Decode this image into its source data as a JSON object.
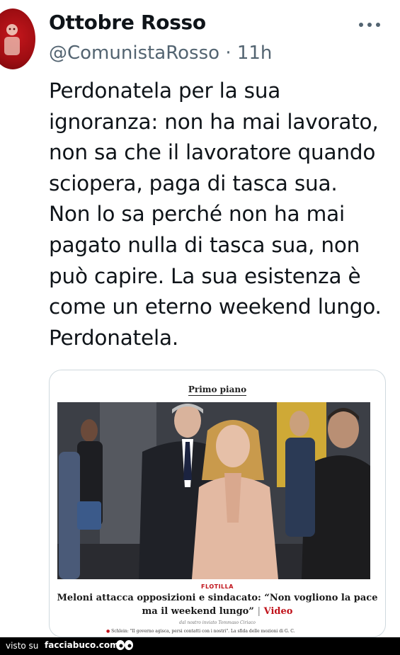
{
  "author": {
    "name": "Ottobre Rosso",
    "handle": "@ComunistaRosso",
    "separator": "·",
    "time": "11h"
  },
  "icons": {
    "more": "more-horizontal-icon",
    "footer_eyes": "eyes-icon"
  },
  "tweet": {
    "lines": [
      "Perdonatela per la sua",
      "ignoranza: non ha mai lavorato,",
      "non sa che il lavoratore quando",
      "sciopera, paga di tasca sua.",
      "Non lo sa perché non ha mai",
      "pagato nulla di tasca sua, non",
      "può capire. La sua esistenza è",
      "come un eterno weekend lungo.",
      "Perdonatela."
    ]
  },
  "card": {
    "kicker": "Primo piano",
    "tag": "FLOTILLA",
    "headline": "Meloni attacca opposizioni e sindacato: “Non vogliono la pace ma il weekend lungo”",
    "separator": "|",
    "video_label": "Video",
    "author_line": "dal nostro inviato Tommaso Ciriaco",
    "related": "Schlein: \"Il governo agisca, persi contatti con i nostri\". La sfida delle mozioni di G. C."
  },
  "footer": {
    "label": "visto su",
    "site": "facciabuco.com"
  },
  "colors": {
    "text": "#0f1419",
    "secondary": "#536471",
    "accent_red": "#c0121a",
    "avatar_red": "#c4161c",
    "footer_bg": "#000000"
  }
}
